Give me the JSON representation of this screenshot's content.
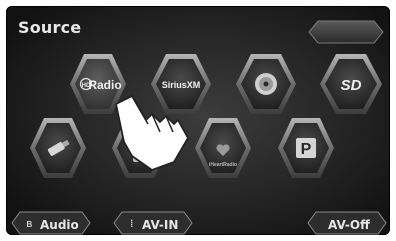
{
  "header": {
    "title": "Source"
  },
  "sources": {
    "hd_radio": {
      "prefix": "HD",
      "label": "Radio"
    },
    "siriusxm": {
      "label": "SiriusXM"
    },
    "disc": {
      "icon": "disc-icon"
    },
    "sd": {
      "icon": "sd-card-icon",
      "label": "SD"
    },
    "usb": {
      "icon": "usb-drive-icon"
    },
    "ipod": {
      "icon": "ipod-icon"
    },
    "iheartradio": {
      "label": "iHeartRadio"
    },
    "pandora": {
      "label": "P"
    }
  },
  "bottom_bar": {
    "bt_audio_label": "Audio",
    "av_in_label": "AV-IN",
    "av_off_label": "AV-Off"
  },
  "colors": {
    "background": "#262626",
    "tile_frame": "#8a8a8a",
    "text": "#e8e8e8"
  }
}
